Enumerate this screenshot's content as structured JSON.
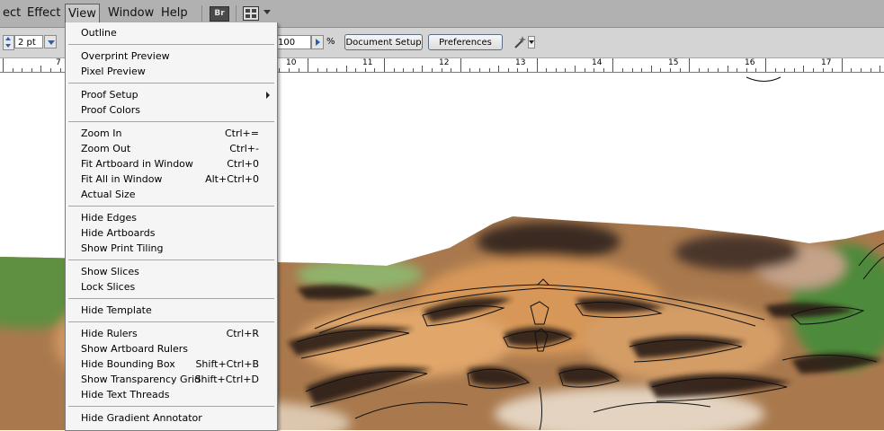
{
  "menubar": {
    "items": [
      "ect",
      "Effect",
      "View",
      "Window",
      "Help"
    ],
    "bridge_label": "Br"
  },
  "control_bar": {
    "stroke_weight": "2 pt",
    "opacity": "100",
    "opacity_unit": "%",
    "document_setup": "Document Setup",
    "preferences": "Preferences"
  },
  "ruler": {
    "labels": [
      "7",
      "10",
      "11",
      "12",
      "13",
      "14",
      "15",
      "16",
      "17"
    ]
  },
  "view_menu": {
    "groups": [
      [
        {
          "label": "Outline",
          "shortcut": ""
        }
      ],
      [
        {
          "label": "Overprint Preview",
          "shortcut": ""
        },
        {
          "label": "Pixel Preview",
          "shortcut": ""
        }
      ],
      [
        {
          "label": "Proof Setup",
          "shortcut": "",
          "submenu": true
        },
        {
          "label": "Proof Colors",
          "shortcut": ""
        }
      ],
      [
        {
          "label": "Zoom In",
          "shortcut": "Ctrl+="
        },
        {
          "label": "Zoom Out",
          "shortcut": "Ctrl+-"
        },
        {
          "label": "Fit Artboard in Window",
          "shortcut": "Ctrl+0"
        },
        {
          "label": "Fit All in Window",
          "shortcut": "Alt+Ctrl+0"
        },
        {
          "label": "Actual Size",
          "shortcut": ""
        }
      ],
      [
        {
          "label": "Hide Edges",
          "shortcut": ""
        },
        {
          "label": "Hide Artboards",
          "shortcut": ""
        },
        {
          "label": "Show Print Tiling",
          "shortcut": ""
        }
      ],
      [
        {
          "label": "Show Slices",
          "shortcut": ""
        },
        {
          "label": "Lock Slices",
          "shortcut": ""
        }
      ],
      [
        {
          "label": "Hide Template",
          "shortcut": ""
        }
      ],
      [
        {
          "label": "Hide Rulers",
          "shortcut": "Ctrl+R"
        },
        {
          "label": "Show Artboard Rulers",
          "shortcut": ""
        },
        {
          "label": "Hide Bounding Box",
          "shortcut": "Shift+Ctrl+B"
        },
        {
          "label": "Show Transparency Grid",
          "shortcut": "Shift+Ctrl+D"
        },
        {
          "label": "Hide Text Threads",
          "shortcut": ""
        }
      ],
      [
        {
          "label": "Hide Gradient Annotator",
          "shortcut": ""
        }
      ]
    ]
  },
  "colors": {
    "menubar_bg": "#b1b1b1",
    "menu_bg": "#f5f5f5",
    "accent_blue": "#2a5fb0"
  },
  "icons": [
    "bridge-icon",
    "workspace-icon",
    "magic-wand-icon",
    "submenu-arrow-icon"
  ]
}
